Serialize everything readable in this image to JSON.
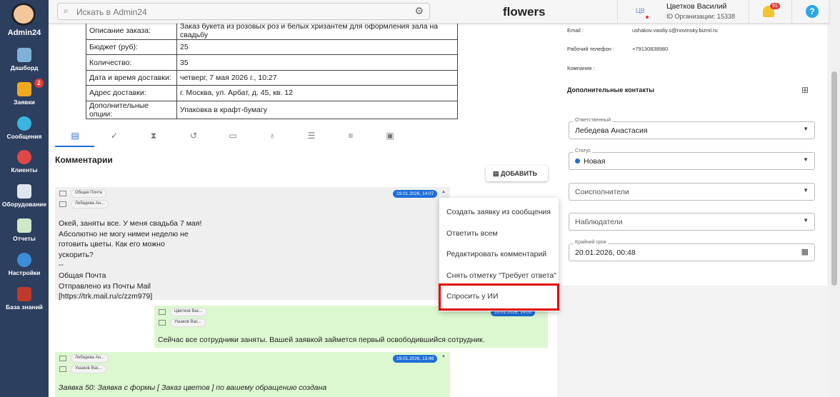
{
  "sidebar": {
    "brand": "Admin24",
    "items": [
      {
        "label": "Дашборд"
      },
      {
        "label": "Заявки",
        "badge": "2"
      },
      {
        "label": "Сообщения"
      },
      {
        "label": "Клиенты"
      },
      {
        "label": "Оборудование"
      },
      {
        "label": "Отчеты"
      },
      {
        "label": "Настройки"
      },
      {
        "label": "База знаний"
      }
    ]
  },
  "header": {
    "search_placeholder": "Искать в Admin24",
    "title": "flowers",
    "user_initials": "ЦВ",
    "user_name": "Цветков Василий",
    "org_id": "ID Организации: 15338",
    "notifications": "91",
    "help": "?"
  },
  "order": [
    {
      "k": "Описание заказа:",
      "v": "Заказ букета из розовых роз и белых хризантем для оформления зала на свадьбу"
    },
    {
      "k": "Бюджет (руб):",
      "v": "25"
    },
    {
      "k": "Количество:",
      "v": "35"
    },
    {
      "k": "Дата и время доставки:",
      "v": "четверг, 7 мая 2026 г., 10:27"
    },
    {
      "k": "Адрес доставки:",
      "v": "г. Москва, ул. Арбат, д. 45, кв. 12"
    },
    {
      "k": "Дополнительные опции:",
      "v": "Упаковка в крафт-бумагу"
    }
  ],
  "comments": {
    "title": "Комментарии",
    "add_label": "ДОБАВИТЬ",
    "messages": [
      {
        "from": "Общая Почта",
        "to": "Лебедева Ан...",
        "date": "19.01.2026, 14:07",
        "lines": [
          "Окей, заняты все. У меня свадьба 7 мая!",
          "Абсолютно не могу нимеи неделю не",
          "готовить цветы. Как его можно",
          "ускорить?",
          "--",
          "Общая Почта",
          "Отправлено из Почты Mail",
          "[https://trk.mail.ru/c/zzm979]"
        ]
      },
      {
        "from": "Цветков Вас...",
        "to": "Ушаков Вас...",
        "date": "19.01.2026, 14:00",
        "lines": [
          "Сейчас все сотрудники заняты. Вашей заявкой займется первый освободившийся сотрудник."
        ]
      },
      {
        "from": "Лебедева Ан...",
        "to": "Ушаков Вас...",
        "date": "19.01.2026, 13:48",
        "lines": [
          "Заявка 50: Заявка с формы [ Заказ цветов ] по вашему обращению создана"
        ]
      }
    ]
  },
  "menu": [
    "Создать заявку из сообщения",
    "Ответить всем",
    "Редактировать комментарий",
    "Снять отметку \"Требует ответа\"",
    "Спросить у ИИ"
  ],
  "contact": {
    "email_label": "Email :",
    "email": "ushakov.vasiliy.s@novinsky.bizml.ru",
    "phone_label": "Рабочий телефон :",
    "phone": "+79130838980",
    "company_label": "Компания :",
    "extra_title": "Дополнительные контакты"
  },
  "fields": {
    "responsible_label": "Ответственный",
    "responsible": "Лебедева Анастасия",
    "status_label": "Статус",
    "status": "Новая",
    "coexec": "Соисполнители",
    "observers": "Наблюдатели",
    "deadline_label": "Крайний срок",
    "deadline": "20.01.2026, 00:48"
  },
  "colors": {
    "sidebar": "#2d3f5e",
    "accent": "#1e6fd9",
    "highlight": "#e00000"
  }
}
